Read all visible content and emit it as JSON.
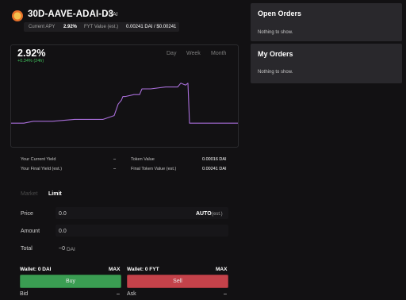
{
  "header": {
    "title": "30D-AAVE-ADAI-⁠D3",
    "unit": "/ DAI",
    "current_apy_label": "Current APY",
    "current_apy_value": "2.92%",
    "fyt_value_label": "FYT Value (est.)",
    "fyt_value_value": "0.00241 DAI / $0.00241"
  },
  "chart": {
    "value": "2.92%",
    "change": "+0.34% (24h)",
    "tabs": [
      "Day",
      "Week",
      "Month"
    ],
    "active_tab": "Day",
    "line_color": "#a86ed9"
  },
  "chart_data": {
    "type": "line",
    "x": [
      0,
      16,
      28,
      52,
      80,
      116,
      130,
      135,
      139,
      141,
      144,
      155,
      162,
      165,
      176,
      195,
      210,
      214,
      220,
      223,
      225,
      230,
      286
    ],
    "values": [
      1.2,
      1.2,
      1.3,
      1.3,
      1.4,
      1.4,
      1.6,
      2.2,
      2.4,
      2.6,
      2.6,
      2.7,
      2.7,
      3.0,
      3.0,
      3.1,
      3.1,
      3.3,
      3.2,
      3.3,
      1.2,
      1.2,
      1.2
    ],
    "ylim": [
      0,
      4
    ]
  },
  "stats": {
    "current_yield_label": "Your Current Yield",
    "current_yield_value": "–",
    "final_yield_label": "Your Final Yield (est.)",
    "final_yield_value": "–",
    "token_value_label": "Token Value",
    "token_value_value": "0.00016 DAI",
    "final_token_value_label": "Final Token Value (est.)",
    "final_token_value_value": "0.00241 DAI"
  },
  "order_tabs": {
    "market": "Market",
    "limit": "Limit",
    "active": "Limit"
  },
  "form": {
    "price_label": "Price",
    "price_value": "0.0",
    "auto_label": "AUTO",
    "auto_suffix": "(est.)",
    "amount_label": "Amount",
    "amount_value": "0.0",
    "total_label": "Total",
    "total_value": "~0",
    "total_unit": "DAI"
  },
  "buy": {
    "wallet_label": "Wallet: 0 DAI",
    "max_label": "MAX",
    "button_label": "Buy",
    "bid_label": "Bid",
    "bid_value": "–",
    "color": "#3a9d52"
  },
  "sell": {
    "wallet_label": "Wallet: 0 FYT",
    "max_label": "MAX",
    "button_label": "Sell",
    "ask_label": "Ask",
    "ask_value": "–",
    "color": "#c4424a"
  },
  "open_orders": {
    "title": "Open Orders",
    "empty": "Nothing to show."
  },
  "my_orders": {
    "title": "My Orders",
    "empty": "Nothing to show."
  }
}
